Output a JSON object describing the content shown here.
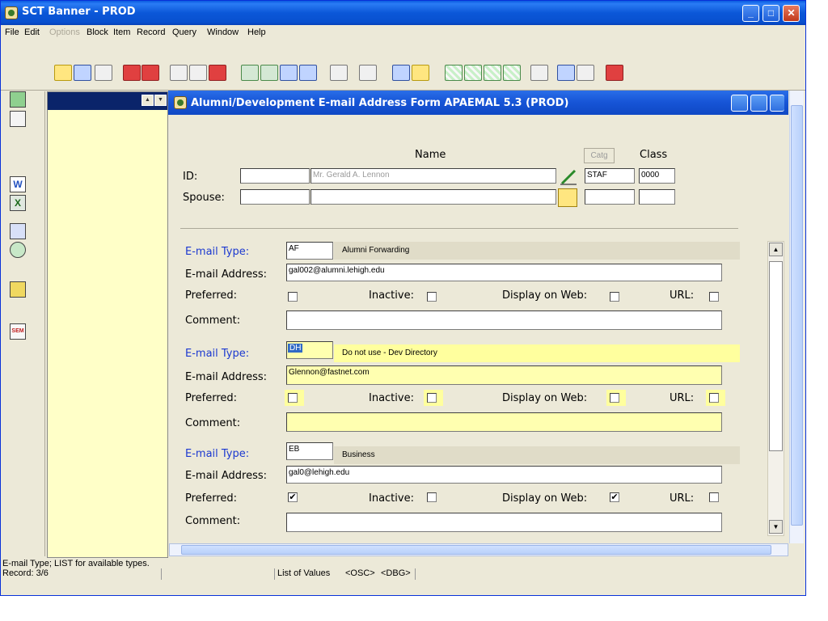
{
  "app": {
    "title": "SCT Banner - PROD"
  },
  "window_buttons": {
    "minimize": "_",
    "maximize": "□",
    "close": "✕"
  },
  "menu": [
    "File",
    "Edit",
    "Options",
    "Block",
    "Item",
    "Record",
    "Query",
    "Window",
    "Help"
  ],
  "menu_disabled": [
    "Options"
  ],
  "form": {
    "title": "Alumni/Development E-mail Address Form  APAEMAL  5.3  (PROD)",
    "name_header": "Name",
    "catg_header": "Catg",
    "class_header": "Class",
    "id_label": "ID:",
    "id_value": "",
    "name_value": "Mr. Gerald A. Lennon",
    "catg_value": "STAF",
    "class_value": "0000",
    "spouse_label": "Spouse:",
    "spouse_id": "",
    "spouse_name": "",
    "spouse_catg": "",
    "spouse_class": ""
  },
  "labels": {
    "email_type": "E-mail Type:",
    "email_address": "E-mail Address:",
    "preferred": "Preferred:",
    "inactive": "Inactive:",
    "display_on_web": "Display on Web:",
    "url": "URL:",
    "comment": "Comment:"
  },
  "records": [
    {
      "type_code": "AF",
      "type_desc": "Alumni Forwarding",
      "address": "gal002@alumni.lehigh.edu",
      "preferred": false,
      "inactive": false,
      "display_on_web": false,
      "url": false,
      "comment": "",
      "current": false
    },
    {
      "type_code": "DH",
      "type_desc": "Do not use - Dev Directory",
      "address": "Glennon@fastnet.com",
      "preferred": false,
      "inactive": false,
      "display_on_web": false,
      "url": false,
      "comment": "",
      "current": true
    },
    {
      "type_code": "EB",
      "type_desc": "Business",
      "address": "gal0@lehigh.edu",
      "preferred": true,
      "inactive": false,
      "display_on_web": true,
      "url": false,
      "comment": "",
      "current": false
    }
  ],
  "status": {
    "hint": "E-mail Type; LIST for available types.",
    "record": "Record: 3/6",
    "lov": "List of Values",
    "osc": "<OSC>",
    "dbg": "<DBG>"
  },
  "check_mark": "✔",
  "colors": {
    "title_blue": "#0b57d8",
    "current_record": "#ffff9e",
    "label_blue": "#1c39d0"
  }
}
